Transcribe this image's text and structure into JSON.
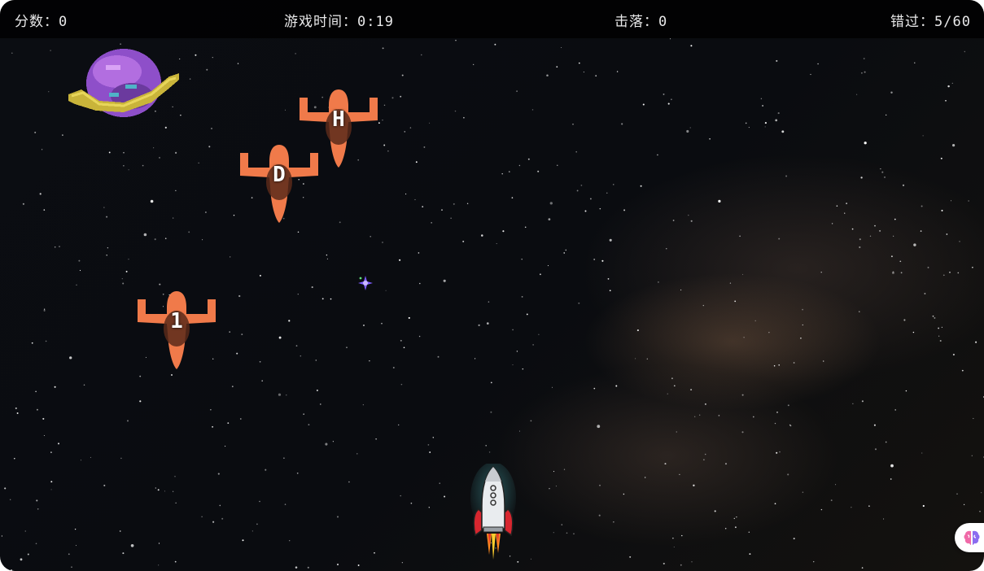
{
  "hud": {
    "score_label": "分数：",
    "score_value": "0",
    "time_label": "游戏时间：",
    "time_value": "0:19",
    "kills_label": "击落：",
    "kills_value": "0",
    "miss_label": "错过：",
    "miss_value": "5/60"
  },
  "enemies": [
    {
      "letter": "H"
    },
    {
      "letter": "D"
    },
    {
      "letter": "1"
    }
  ],
  "sprites": {
    "enemy_color": "#f07a4a",
    "planet_icon": "ringed-planet-icon",
    "player_icon": "rocket-icon",
    "pickup_icon": "sparkle-icon",
    "helper_icon": "brain-icon"
  }
}
